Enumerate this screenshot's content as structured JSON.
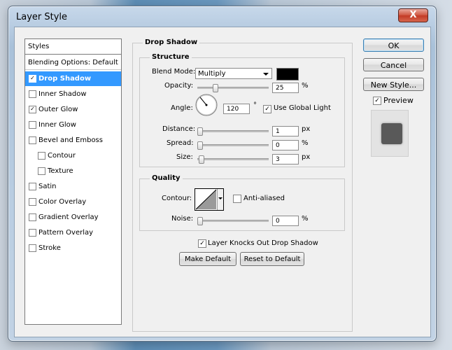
{
  "window": {
    "title": "Layer Style",
    "close_label": "X"
  },
  "styles_panel": {
    "header": "Styles",
    "items": [
      {
        "label": "Blending Options: Default",
        "checked": null
      },
      {
        "label": "Drop Shadow",
        "checked": true,
        "selected": true
      },
      {
        "label": "Inner Shadow",
        "checked": false
      },
      {
        "label": "Outer Glow",
        "checked": true
      },
      {
        "label": "Inner Glow",
        "checked": false
      },
      {
        "label": "Bevel and Emboss",
        "checked": false
      },
      {
        "label": "Contour",
        "checked": false
      },
      {
        "label": "Texture",
        "checked": false
      },
      {
        "label": "Satin",
        "checked": false
      },
      {
        "label": "Color Overlay",
        "checked": false
      },
      {
        "label": "Gradient Overlay",
        "checked": false
      },
      {
        "label": "Pattern Overlay",
        "checked": false
      },
      {
        "label": "Stroke",
        "checked": false
      }
    ]
  },
  "drop_shadow": {
    "title": "Drop Shadow",
    "structure": {
      "title": "Structure",
      "blend_mode_label": "Blend Mode:",
      "blend_mode_value": "Multiply",
      "shadow_color": "#000000",
      "opacity_label": "Opacity:",
      "opacity_value": "25",
      "opacity_unit": "%",
      "angle_label": "Angle:",
      "angle_value": "120",
      "angle_unit": "°",
      "use_global_light_label": "Use Global Light",
      "use_global_light_checked": true,
      "distance_label": "Distance:",
      "distance_value": "1",
      "distance_unit": "px",
      "spread_label": "Spread:",
      "spread_value": "0",
      "spread_unit": "%",
      "size_label": "Size:",
      "size_value": "3",
      "size_unit": "px"
    },
    "quality": {
      "title": "Quality",
      "contour_label": "Contour:",
      "anti_aliased_label": "Anti-aliased",
      "anti_aliased_checked": false,
      "noise_label": "Noise:",
      "noise_value": "0",
      "noise_unit": "%"
    },
    "knockout_label": "Layer Knocks Out Drop Shadow",
    "knockout_checked": true,
    "make_default_label": "Make Default",
    "reset_default_label": "Reset to Default"
  },
  "buttons": {
    "ok": "OK",
    "cancel": "Cancel",
    "new_style": "New Style..."
  },
  "preview": {
    "label": "Preview",
    "checked": true
  },
  "colors": {
    "selection": "#3399ff",
    "dialog_bg": "#f0f0f0",
    "window_frame": "#b9cde1"
  }
}
